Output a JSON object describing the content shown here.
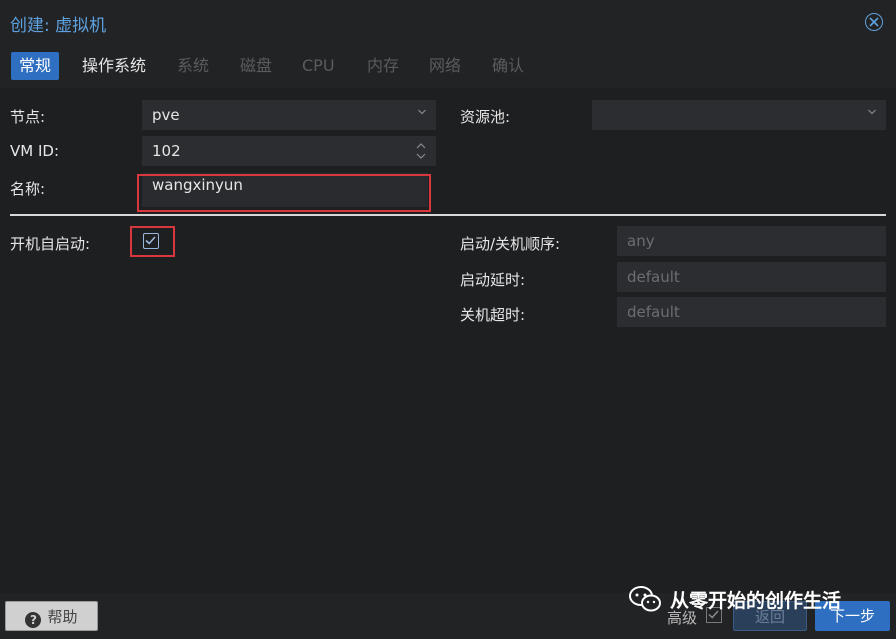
{
  "window": {
    "title": "创建: 虚拟机"
  },
  "tabs": [
    {
      "label": "常规",
      "active": true
    },
    {
      "label": "操作系统",
      "enabled": true
    },
    {
      "label": "系统"
    },
    {
      "label": "磁盘"
    },
    {
      "label": "CPU"
    },
    {
      "label": "内存"
    },
    {
      "label": "网络"
    },
    {
      "label": "确认"
    }
  ],
  "form": {
    "node_label": "节点:",
    "node_value": "pve",
    "vmid_label": "VM ID:",
    "vmid_value": "102",
    "name_label": "名称:",
    "name_value": "wangxinyun",
    "pool_label": "资源池:",
    "pool_value": "",
    "onboot_label": "开机自启动:",
    "onboot_checked": true,
    "order_label": "启动/关机顺序:",
    "order_placeholder": "any",
    "delay_label": "启动延时:",
    "delay_placeholder": "default",
    "shutdown_label": "关机超时:",
    "shutdown_placeholder": "default"
  },
  "footer": {
    "help_label": "帮助",
    "advanced_label": "高级",
    "advanced_checked": true,
    "back_label": "返回",
    "next_label": "下一步"
  },
  "watermark": {
    "text": "从零开始的创作生活"
  },
  "colors": {
    "accent": "#2f6fc1",
    "title": "#5ea1df",
    "highlight": "#d9363e",
    "background": "#222325"
  }
}
